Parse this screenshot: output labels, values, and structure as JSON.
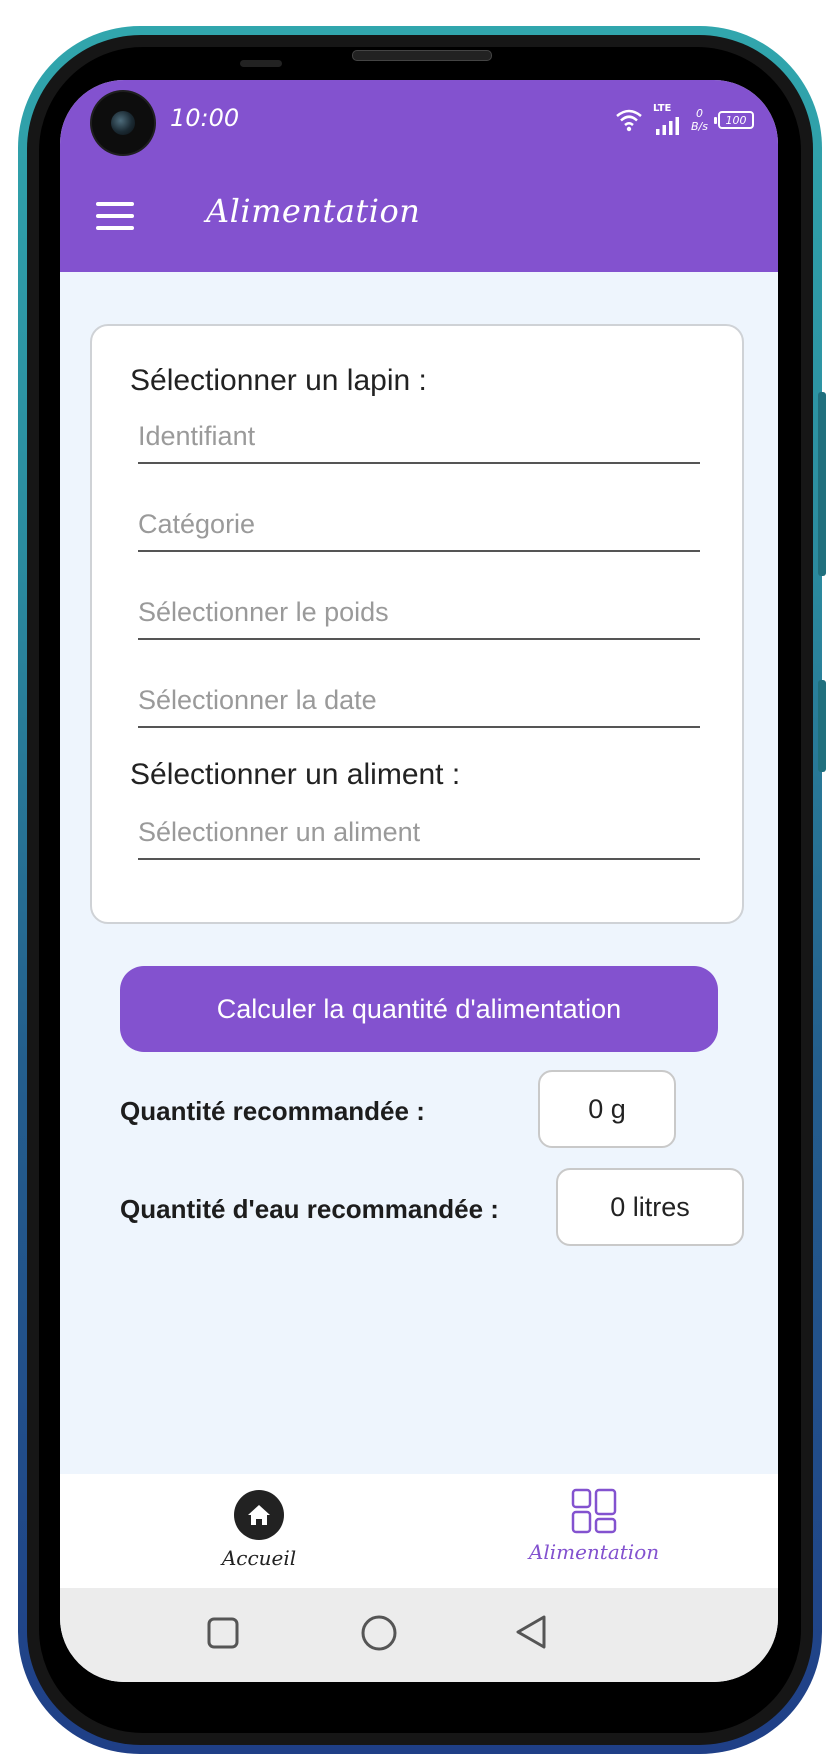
{
  "status_bar": {
    "time": "10:00",
    "network": "LTE",
    "speed_value": "0",
    "speed_unit": "B/s",
    "battery": "100"
  },
  "appbar": {
    "title": "Alimentation",
    "menu_icon": "hamburger-menu-icon"
  },
  "form": {
    "rabbit_section_label": "Sélectionner un lapin :",
    "fields": {
      "identifier_placeholder": "Identifiant",
      "category_placeholder": "Catégorie",
      "weight_placeholder": "Sélectionner le poids",
      "date_placeholder": "Sélectionner la date"
    },
    "food_section_label": "Sélectionner un aliment :",
    "food_placeholder": "Sélectionner un aliment"
  },
  "calculate_button_label": "Calculer la quantité d'alimentation",
  "results": {
    "food_quantity_label": "Quantité recommandée :",
    "food_quantity_value": "0 g",
    "water_quantity_label": "Quantité d'eau recommandée :",
    "water_quantity_value": "0 litres"
  },
  "bottom_nav": {
    "items": [
      {
        "label": "Accueil",
        "icon": "home-icon",
        "active": false
      },
      {
        "label": "Alimentation",
        "icon": "dashboard-icon",
        "active": true
      }
    ],
    "active_color": "#8352cf",
    "inactive_color": "#222222"
  },
  "colors": {
    "primary": "#8352cf",
    "background": "#eef5fd"
  }
}
